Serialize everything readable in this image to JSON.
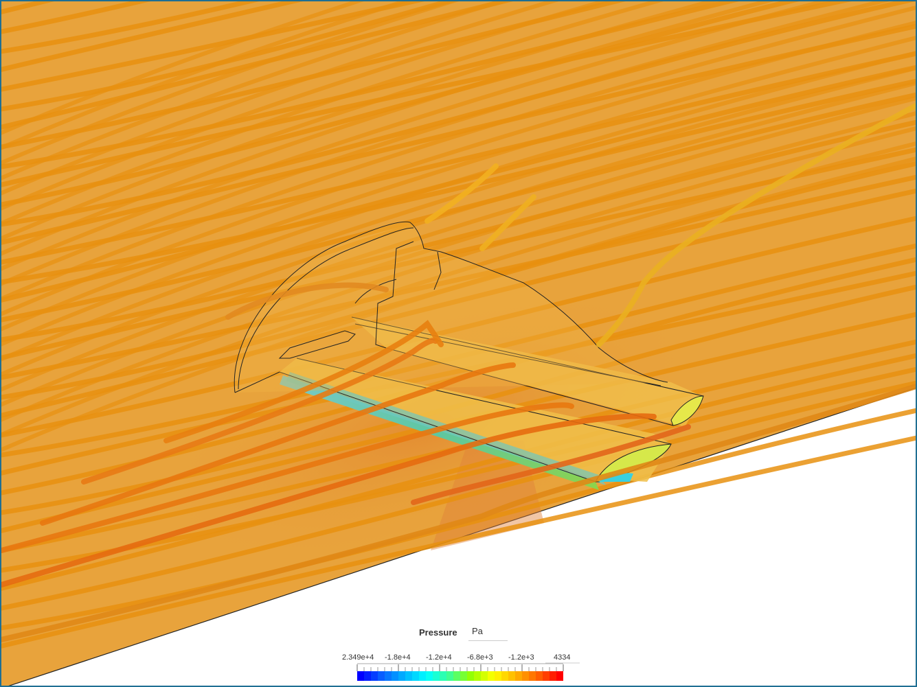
{
  "legend": {
    "title": "Pressure",
    "unit": "Pa",
    "ticks": [
      "2.349e+4",
      "-1.8e+4",
      "-1.2e+4",
      "-6.8e+3",
      "-1.2e+3",
      "4334"
    ],
    "min_label": "2.349e+4",
    "max_label": "4334",
    "colors": [
      "#0000ff",
      "#0a64ff",
      "#00b4ff",
      "#00ffff",
      "#3cff96",
      "#96ff00",
      "#ffff00",
      "#ffb400",
      "#ff6400",
      "#ff0000"
    ]
  },
  "scene": {
    "background_color": "#e8a33c",
    "streamline_color": "#e8900f",
    "floor_color": "#ffffff",
    "border_color": "#1f6f93"
  }
}
